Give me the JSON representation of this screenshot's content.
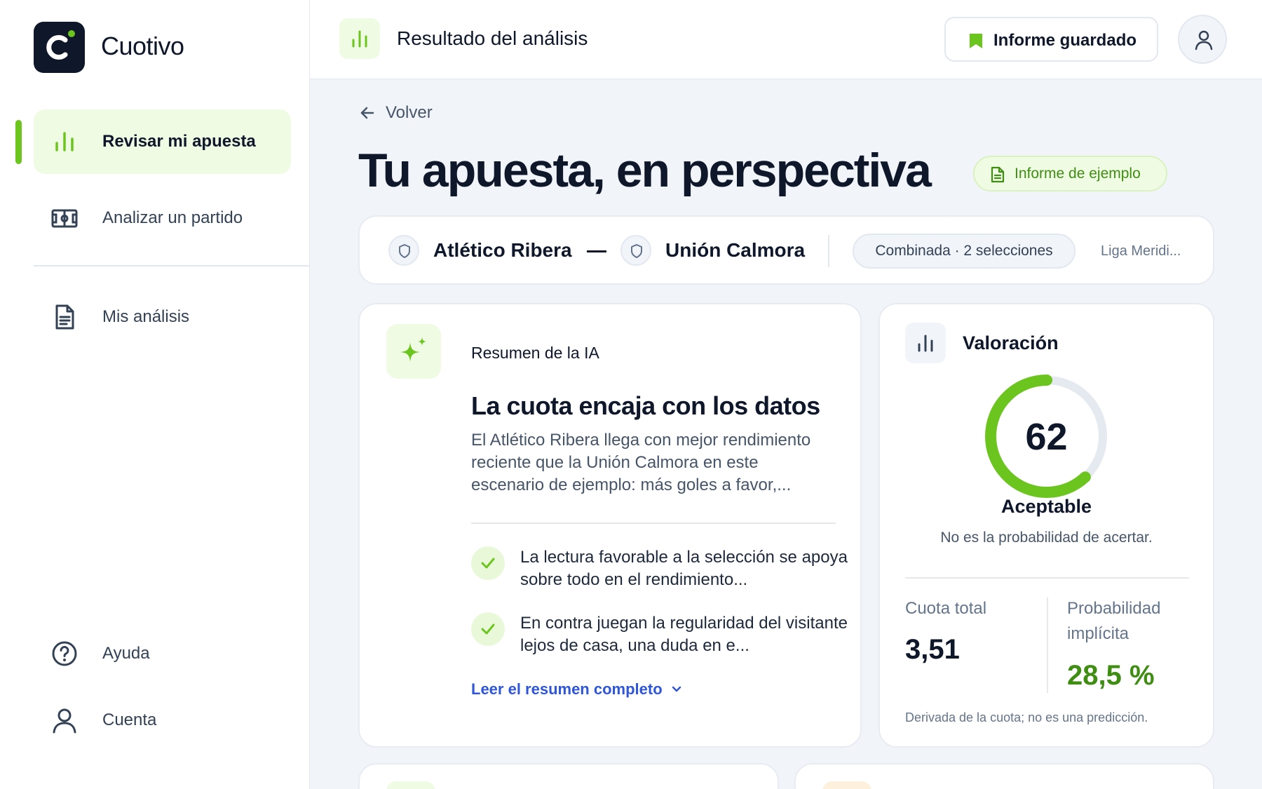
{
  "app": {
    "brand": "Cuotivo",
    "colors": {
      "accent": "#6cc51f",
      "accent_soft": "#f0fbe4",
      "link": "#2f56d6",
      "text": "#0f172a"
    }
  },
  "sidebar": {
    "items": [
      {
        "label": "Revisar mi apuesta",
        "icon": "bar-chart-icon",
        "active": true
      },
      {
        "label": "Analizar un partido",
        "icon": "football-pitch-icon",
        "active": false
      },
      {
        "label": "Mis análisis",
        "icon": "document-icon",
        "active": false
      }
    ],
    "footer_items": [
      {
        "label": "Ayuda",
        "icon": "help-circle-icon"
      },
      {
        "label": "Cuenta",
        "icon": "user-icon"
      }
    ]
  },
  "topbar": {
    "title": "Resultado del análisis",
    "saved_label": "Informe guardado"
  },
  "page": {
    "back_label": "Volver",
    "title": "Tu apuesta, en perspectiva",
    "example_badge": "Informe de ejemplo"
  },
  "match": {
    "home_team": "Atlético Ribera",
    "away_team": "Unión Calmora",
    "bet_type": "Combinada · 2 selecciones",
    "league": "Liga Meridi..."
  },
  "summary": {
    "kicker": "Resumen de la IA",
    "headline": "La cuota encaja con los datos",
    "body": "El Atlético Ribera llega con mejor rendimiento reciente que la Unión Calmora en este escenario de ejemplo: más goles a favor,...",
    "points": [
      "La lectura favorable a la selección se apoya sobre todo en el rendimiento...",
      "En contra juegan la regularidad del visitante lejos de casa, una duda en e..."
    ],
    "read_more": "Leer el resumen completo"
  },
  "valuation": {
    "title": "Valoración",
    "score": 62,
    "score_max": 100,
    "score_text": "62",
    "rating": "Aceptable",
    "note": "No es la probabilidad de acertar.",
    "odds_label": "Cuota total",
    "odds_value": "3,51",
    "prob_label": "Probabilidad implícita",
    "prob_value": "28,5 %",
    "footnote": "Derivada de la cuota; no es una predicción."
  }
}
